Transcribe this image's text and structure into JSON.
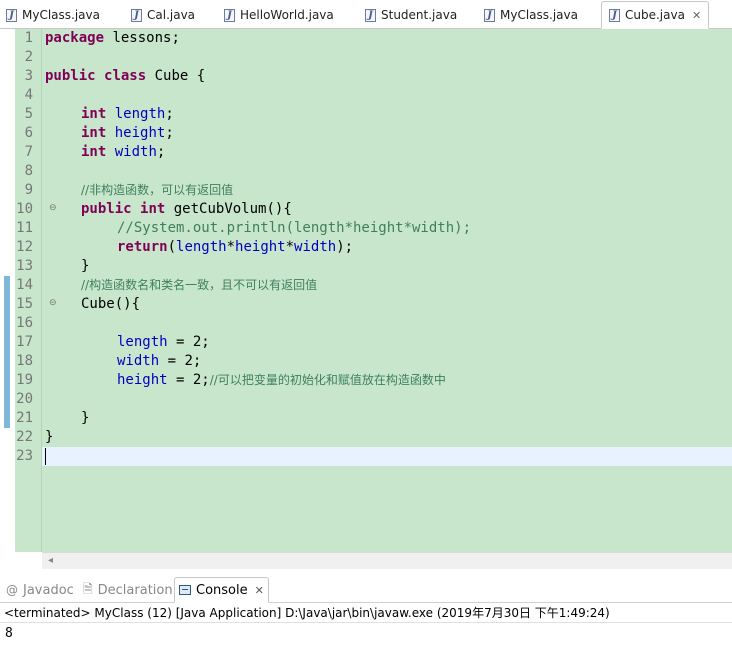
{
  "tabs": [
    {
      "label": "MyClass.java",
      "active": false
    },
    {
      "label": "Cal.java",
      "active": false
    },
    {
      "label": "HelloWorld.java",
      "active": false
    },
    {
      "label": "Student.java",
      "active": false
    },
    {
      "label": "MyClass.java",
      "active": false
    },
    {
      "label": "Cube.java",
      "active": true
    }
  ],
  "editor": {
    "line_numbers": [
      "1",
      "2",
      "3",
      "4",
      "5",
      "6",
      "7",
      "8",
      "9",
      "10",
      "11",
      "12",
      "13",
      "14",
      "15",
      "16",
      "17",
      "18",
      "19",
      "20",
      "21",
      "22",
      "23"
    ],
    "lines": {
      "l1_kw": "package",
      "l1_rest": " lessons;",
      "l3_kw1": "public",
      "l3_kw2": "class",
      "l3_rest": " Cube {",
      "l5_kw": "int",
      "l5_fld": "length",
      "l5_end": ";",
      "l6_kw": "int",
      "l6_fld": "height",
      "l6_end": ";",
      "l7_kw": "int",
      "l7_fld": "width",
      "l7_end": ";",
      "l9_cmt": "//非构造函数，可以有返回值",
      "l10_kw1": "public",
      "l10_kw2": "int",
      "l10_rest": " getCubVolum(){",
      "l11_cmt": "//System.out.println(length*height*width);",
      "l12_kw": "return",
      "l12_p1": "(",
      "l12_f1": "length",
      "l12_op1": "*",
      "l12_f2": "height",
      "l12_op2": "*",
      "l12_f3": "width",
      "l12_end": ");",
      "l13": "}",
      "l14_cmt": "//构造函数名和类名一致，且不可以有返回值",
      "l15": "Cube(){",
      "l17_fld": "length",
      "l17_rest": " = 2;",
      "l18_fld": "width",
      "l18_rest": " = 2;",
      "l19_fld": "height",
      "l19_rest": " = 2;",
      "l19_cmt": "//可以把变量的初始化和赋值放在构造函数中",
      "l21": "}",
      "l22": "}"
    }
  },
  "bottom_panel": {
    "tabs": [
      {
        "label": "Javadoc",
        "icon": "at-icon",
        "active": false
      },
      {
        "label": "Declaration",
        "icon": "declaration-icon",
        "active": false
      },
      {
        "label": "Console",
        "icon": "console-icon",
        "active": true
      }
    ],
    "console_header": "<terminated> MyClass (12) [Java Application] D:\\Java\\jar\\bin\\javaw.exe (2019年7月30日 下午1:49:24)",
    "console_output": "8"
  }
}
